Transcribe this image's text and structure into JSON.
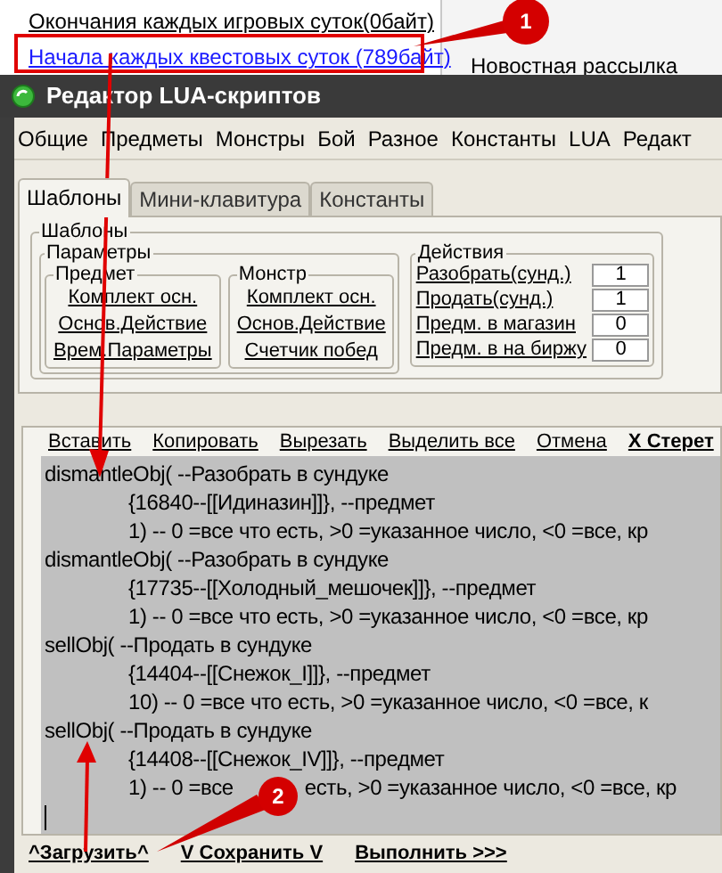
{
  "background": {
    "links": [
      {
        "label": "Окончания каждых игровых суток(0байт)",
        "highlighted": false
      },
      {
        "label": "Начала каждых квестовых суток (789байт)",
        "highlighted": true
      }
    ],
    "side_text": "Новостная рассылка"
  },
  "window": {
    "title": "Редактор LUA-скриптов"
  },
  "menu": [
    "Общие",
    "Предметы",
    "Монстры",
    "Бой",
    "Разное",
    "Константы",
    "LUA",
    "Редакт"
  ],
  "tabs": [
    {
      "label": "Шаблоны",
      "selected": true
    },
    {
      "label": "Мини-клавитура",
      "selected": false
    },
    {
      "label": "Константы",
      "selected": false
    }
  ],
  "templates": {
    "title": "Шаблоны",
    "params_title": "Параметры",
    "item": {
      "title": "Предмет",
      "links": [
        "Комплект осн.",
        "Основ.Действие",
        "Врем.Параметры"
      ]
    },
    "monster": {
      "title": "Монстр",
      "links": [
        "Комплект осн.",
        "Основ.Действие",
        "Счетчик побед"
      ]
    },
    "actions": {
      "title": "Действия",
      "rows": [
        {
          "label": "Разобрать(сунд.)",
          "value": "1"
        },
        {
          "label": "Продать(сунд.)",
          "value": "1"
        },
        {
          "label": "Предм. в магазин",
          "value": "0"
        },
        {
          "label": "Предм. в на биржу",
          "value": "0"
        }
      ]
    }
  },
  "editor_toolbar": [
    {
      "label": "Вставить",
      "bold": false
    },
    {
      "label": "Копировать",
      "bold": false
    },
    {
      "label": "Вырезать",
      "bold": false
    },
    {
      "label": "Выделить все",
      "bold": false
    },
    {
      "label": "Отмена",
      "bold": false
    },
    {
      "label": "X Стерет",
      "bold": true
    }
  ],
  "code_lines": [
    {
      "kind": "call",
      "parts": [
        "dismantleObj( --Разобрать в сундуке"
      ]
    },
    {
      "kind": "arg",
      "parts": [
        "{16840--[[Идиназин]]}, --предмет"
      ]
    },
    {
      "kind": "arg",
      "parts": [
        "1) -- 0 =все что есть, >0 =указанное число, <0 =все, кр"
      ]
    },
    {
      "kind": "call",
      "parts": [
        "dismantleObj( --Разобрать в сундуке"
      ]
    },
    {
      "kind": "arg",
      "parts": [
        "{17735--[[Холодный_мешочек]]}, --предмет"
      ]
    },
    {
      "kind": "arg",
      "parts": [
        "1) -- 0 =все что есть, >0 =указанное число, <0 =все, кр"
      ]
    },
    {
      "kind": "call",
      "parts": [
        "sellObj( --Продать в сундуке"
      ]
    },
    {
      "kind": "arg",
      "parts": [
        "{14404--[[Снежок_I]]}, --предмет"
      ]
    },
    {
      "kind": "arg",
      "parts": [
        "10) -- 0 =все что есть, >0 =указанное число, <0 =все, к"
      ]
    },
    {
      "kind": "call",
      "parts": [
        "sellObj( --Продать в сундуке"
      ]
    },
    {
      "kind": "arg",
      "parts": [
        "{14408--[[Снежок_IV]]}, --предмет"
      ]
    },
    {
      "kind": "arg",
      "parts": [
        "1) -- 0 =все",
        "есть, >0 =указанное число, <0 =все, кр"
      ]
    }
  ],
  "bottom_buttons": [
    "^Загрузить^",
    "V Сохранить V",
    "Выполнить >>>"
  ],
  "callouts": [
    "1",
    "2"
  ]
}
